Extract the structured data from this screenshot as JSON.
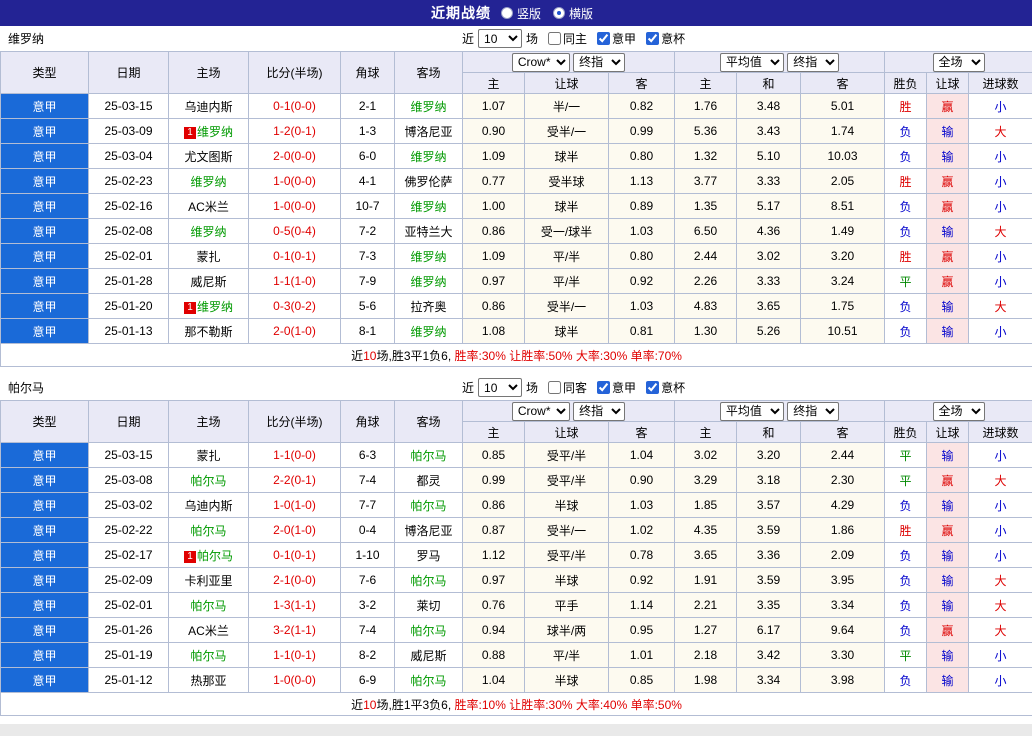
{
  "topbar": {
    "title": "近期战绩",
    "vertical_label": "竖版",
    "vertical_checked": false,
    "horizontal_label": "横版",
    "horizontal_checked": true
  },
  "labels": {
    "near": "近",
    "count": "10",
    "matches": "场"
  },
  "table_header": {
    "col_type": "类型",
    "col_date": "日期",
    "col_home": "主场",
    "col_score": "比分(半场)",
    "col_corner": "角球",
    "col_away": "客场",
    "bookmaker_select": "Crow*",
    "asia_final_select": "终指",
    "average_select": "平均值",
    "euro_final_select": "终指",
    "full_select": "全场",
    "sub": [
      "主",
      "让球",
      "客",
      "主",
      "和",
      "客",
      "胜负",
      "让球",
      "进球数"
    ]
  },
  "colors": {
    "win": "#dd0000",
    "draw": "#008800",
    "loss": "#0000cc",
    "over": "#dd0000",
    "under": "#0000cc",
    "league_cell": "#1a6ad8",
    "subject_team": "#009a00",
    "score": "#e00000",
    "topbar_bg": "#232394"
  },
  "sections": [
    {
      "team": "维罗纳",
      "filter": {
        "same_label": "同主",
        "same_checked": false,
        "league_label": "意甲",
        "league_checked": true,
        "cup_label": "意杯",
        "cup_checked": true
      },
      "rows": [
        {
          "type": "意甲",
          "date": "25-03-15",
          "home": "乌迪内斯",
          "home_badge": "",
          "home_subject": false,
          "score": "0-1(0-0)",
          "corner": "2-1",
          "away": "维罗纳",
          "away_badge": "",
          "away_subject": true,
          "asia": [
            "1.07",
            "半/一",
            "0.82"
          ],
          "europe": [
            "1.76",
            "3.48",
            "5.01"
          ],
          "wdl": "胜",
          "handicap": "赢",
          "goals": "小"
        },
        {
          "type": "意甲",
          "date": "25-03-09",
          "home": "维罗纳",
          "home_badge": "1",
          "home_subject": true,
          "score": "1-2(0-1)",
          "corner": "1-3",
          "away": "博洛尼亚",
          "away_badge": "",
          "away_subject": false,
          "asia": [
            "0.90",
            "受半/一",
            "0.99"
          ],
          "europe": [
            "5.36",
            "3.43",
            "1.74"
          ],
          "wdl": "负",
          "handicap": "输",
          "goals": "大"
        },
        {
          "type": "意甲",
          "date": "25-03-04",
          "home": "尤文图斯",
          "home_badge": "",
          "home_subject": false,
          "score": "2-0(0-0)",
          "corner": "6-0",
          "away": "维罗纳",
          "away_badge": "",
          "away_subject": true,
          "asia": [
            "1.09",
            "球半",
            "0.80"
          ],
          "europe": [
            "1.32",
            "5.10",
            "10.03"
          ],
          "wdl": "负",
          "handicap": "输",
          "goals": "小"
        },
        {
          "type": "意甲",
          "date": "25-02-23",
          "home": "维罗纳",
          "home_badge": "",
          "home_subject": true,
          "score": "1-0(0-0)",
          "corner": "4-1",
          "away": "佛罗伦萨",
          "away_badge": "",
          "away_subject": false,
          "asia": [
            "0.77",
            "受半球",
            "1.13"
          ],
          "europe": [
            "3.77",
            "3.33",
            "2.05"
          ],
          "wdl": "胜",
          "handicap": "赢",
          "goals": "小"
        },
        {
          "type": "意甲",
          "date": "25-02-16",
          "home": "AC米兰",
          "home_badge": "",
          "home_subject": false,
          "score": "1-0(0-0)",
          "corner": "10-7",
          "away": "维罗纳",
          "away_badge": "",
          "away_subject": true,
          "asia": [
            "1.00",
            "球半",
            "0.89"
          ],
          "europe": [
            "1.35",
            "5.17",
            "8.51"
          ],
          "wdl": "负",
          "handicap": "赢",
          "goals": "小"
        },
        {
          "type": "意甲",
          "date": "25-02-08",
          "home": "维罗纳",
          "home_badge": "",
          "home_subject": true,
          "score": "0-5(0-4)",
          "corner": "7-2",
          "away": "亚特兰大",
          "away_badge": "",
          "away_subject": false,
          "asia": [
            "0.86",
            "受一/球半",
            "1.03"
          ],
          "europe": [
            "6.50",
            "4.36",
            "1.49"
          ],
          "wdl": "负",
          "handicap": "输",
          "goals": "大"
        },
        {
          "type": "意甲",
          "date": "25-02-01",
          "home": "蒙扎",
          "home_badge": "",
          "home_subject": false,
          "score": "0-1(0-1)",
          "corner": "7-3",
          "away": "维罗纳",
          "away_badge": "",
          "away_subject": true,
          "asia": [
            "1.09",
            "平/半",
            "0.80"
          ],
          "europe": [
            "2.44",
            "3.02",
            "3.20"
          ],
          "wdl": "胜",
          "handicap": "赢",
          "goals": "小"
        },
        {
          "type": "意甲",
          "date": "25-01-28",
          "home": "威尼斯",
          "home_badge": "",
          "home_subject": false,
          "score": "1-1(1-0)",
          "corner": "7-9",
          "away": "维罗纳",
          "away_badge": "",
          "away_subject": true,
          "asia": [
            "0.97",
            "平/半",
            "0.92"
          ],
          "europe": [
            "2.26",
            "3.33",
            "3.24"
          ],
          "wdl": "平",
          "handicap": "赢",
          "goals": "小"
        },
        {
          "type": "意甲",
          "date": "25-01-20",
          "home": "维罗纳",
          "home_badge": "1",
          "home_subject": true,
          "score": "0-3(0-2)",
          "corner": "5-6",
          "away": "拉齐奥",
          "away_badge": "",
          "away_subject": false,
          "asia": [
            "0.86",
            "受半/一",
            "1.03"
          ],
          "europe": [
            "4.83",
            "3.65",
            "1.75"
          ],
          "wdl": "负",
          "handicap": "输",
          "goals": "大"
        },
        {
          "type": "意甲",
          "date": "25-01-13",
          "home": "那不勒斯",
          "home_badge": "",
          "home_subject": false,
          "score": "2-0(1-0)",
          "corner": "8-1",
          "away": "维罗纳",
          "away_badge": "",
          "away_subject": true,
          "asia": [
            "1.08",
            "球半",
            "0.81"
          ],
          "europe": [
            "1.30",
            "5.26",
            "10.51"
          ],
          "wdl": "负",
          "handicap": "输",
          "goals": "小"
        }
      ],
      "summary": {
        "p1": "近",
        "count": "10",
        "p2": "场,胜3平1负6, ",
        "stats": "胜率:30% 让胜率:50% 大率:30% 单率:70%"
      }
    },
    {
      "team": "帕尔马",
      "filter": {
        "same_label": "同客",
        "same_checked": false,
        "league_label": "意甲",
        "league_checked": true,
        "cup_label": "意杯",
        "cup_checked": true
      },
      "rows": [
        {
          "type": "意甲",
          "date": "25-03-15",
          "home": "蒙扎",
          "home_badge": "",
          "home_subject": false,
          "score": "1-1(0-0)",
          "corner": "6-3",
          "away": "帕尔马",
          "away_badge": "",
          "away_subject": true,
          "asia": [
            "0.85",
            "受平/半",
            "1.04"
          ],
          "europe": [
            "3.02",
            "3.20",
            "2.44"
          ],
          "wdl": "平",
          "handicap": "输",
          "goals": "小"
        },
        {
          "type": "意甲",
          "date": "25-03-08",
          "home": "帕尔马",
          "home_badge": "",
          "home_subject": true,
          "score": "2-2(0-1)",
          "corner": "7-4",
          "away": "都灵",
          "away_badge": "",
          "away_subject": false,
          "asia": [
            "0.99",
            "受平/半",
            "0.90"
          ],
          "europe": [
            "3.29",
            "3.18",
            "2.30"
          ],
          "wdl": "平",
          "handicap": "赢",
          "goals": "大"
        },
        {
          "type": "意甲",
          "date": "25-03-02",
          "home": "乌迪内斯",
          "home_badge": "",
          "home_subject": false,
          "score": "1-0(1-0)",
          "corner": "7-7",
          "away": "帕尔马",
          "away_badge": "",
          "away_subject": true,
          "asia": [
            "0.86",
            "半球",
            "1.03"
          ],
          "europe": [
            "1.85",
            "3.57",
            "4.29"
          ],
          "wdl": "负",
          "handicap": "输",
          "goals": "小"
        },
        {
          "type": "意甲",
          "date": "25-02-22",
          "home": "帕尔马",
          "home_badge": "",
          "home_subject": true,
          "score": "2-0(1-0)",
          "corner": "0-4",
          "away": "博洛尼亚",
          "away_badge": "",
          "away_subject": false,
          "asia": [
            "0.87",
            "受半/一",
            "1.02"
          ],
          "europe": [
            "4.35",
            "3.59",
            "1.86"
          ],
          "wdl": "胜",
          "handicap": "赢",
          "goals": "小"
        },
        {
          "type": "意甲",
          "date": "25-02-17",
          "home": "帕尔马",
          "home_badge": "1",
          "home_subject": true,
          "score": "0-1(0-1)",
          "corner": "1-10",
          "away": "罗马",
          "away_badge": "",
          "away_subject": false,
          "asia": [
            "1.12",
            "受平/半",
            "0.78"
          ],
          "europe": [
            "3.65",
            "3.36",
            "2.09"
          ],
          "wdl": "负",
          "handicap": "输",
          "goals": "小"
        },
        {
          "type": "意甲",
          "date": "25-02-09",
          "home": "卡利亚里",
          "home_badge": "",
          "home_subject": false,
          "score": "2-1(0-0)",
          "corner": "7-6",
          "away": "帕尔马",
          "away_badge": "",
          "away_subject": true,
          "asia": [
            "0.97",
            "半球",
            "0.92"
          ],
          "europe": [
            "1.91",
            "3.59",
            "3.95"
          ],
          "wdl": "负",
          "handicap": "输",
          "goals": "大"
        },
        {
          "type": "意甲",
          "date": "25-02-01",
          "home": "帕尔马",
          "home_badge": "",
          "home_subject": true,
          "score": "1-3(1-1)",
          "corner": "3-2",
          "away": "莱切",
          "away_badge": "",
          "away_subject": false,
          "asia": [
            "0.76",
            "平手",
            "1.14"
          ],
          "europe": [
            "2.21",
            "3.35",
            "3.34"
          ],
          "wdl": "负",
          "handicap": "输",
          "goals": "大"
        },
        {
          "type": "意甲",
          "date": "25-01-26",
          "home": "AC米兰",
          "home_badge": "",
          "home_subject": false,
          "score": "3-2(1-1)",
          "corner": "7-4",
          "away": "帕尔马",
          "away_badge": "",
          "away_subject": true,
          "asia": [
            "0.94",
            "球半/两",
            "0.95"
          ],
          "europe": [
            "1.27",
            "6.17",
            "9.64"
          ],
          "wdl": "负",
          "handicap": "赢",
          "goals": "大"
        },
        {
          "type": "意甲",
          "date": "25-01-19",
          "home": "帕尔马",
          "home_badge": "",
          "home_subject": true,
          "score": "1-1(0-1)",
          "corner": "8-2",
          "away": "威尼斯",
          "away_badge": "",
          "away_subject": false,
          "asia": [
            "0.88",
            "平/半",
            "1.01"
          ],
          "europe": [
            "2.18",
            "3.42",
            "3.30"
          ],
          "wdl": "平",
          "handicap": "输",
          "goals": "小"
        },
        {
          "type": "意甲",
          "date": "25-01-12",
          "home": "热那亚",
          "home_badge": "",
          "home_subject": false,
          "score": "1-0(0-0)",
          "corner": "6-9",
          "away": "帕尔马",
          "away_badge": "",
          "away_subject": true,
          "asia": [
            "1.04",
            "半球",
            "0.85"
          ],
          "europe": [
            "1.98",
            "3.34",
            "3.98"
          ],
          "wdl": "负",
          "handicap": "输",
          "goals": "小"
        }
      ],
      "summary": {
        "p1": "近",
        "count": "10",
        "p2": "场,胜1平3负6, ",
        "stats": "胜率:10% 让胜率:30% 大率:40% 单率:50%"
      }
    }
  ]
}
